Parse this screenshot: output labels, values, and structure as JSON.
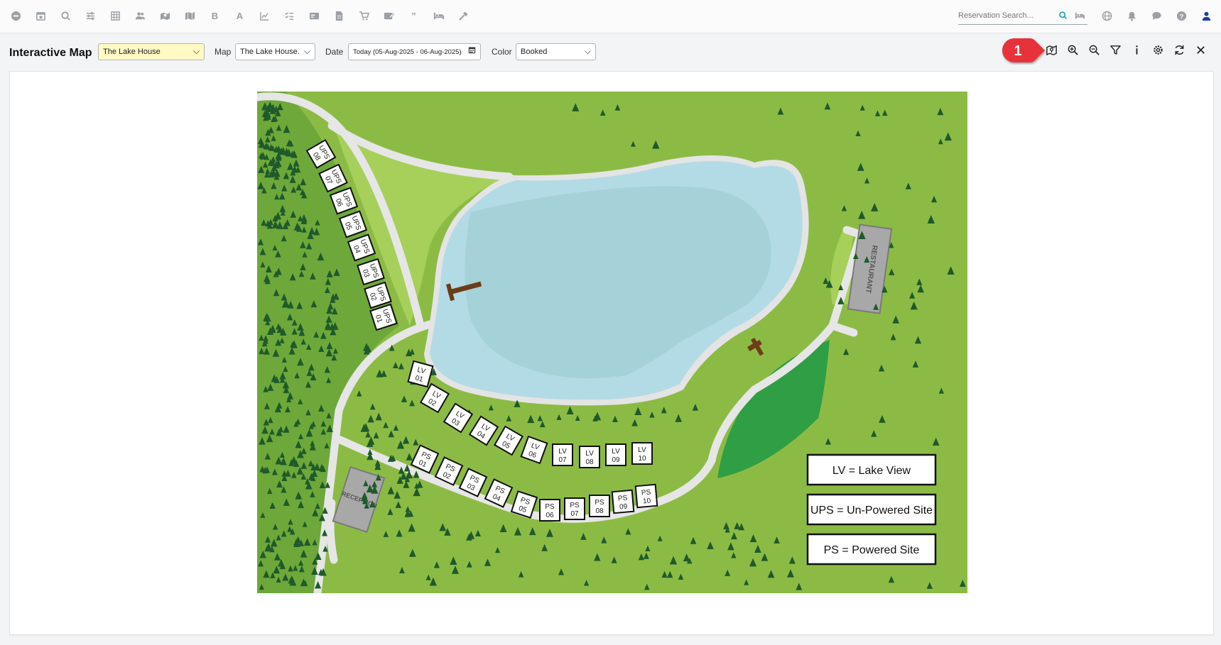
{
  "topbar": {
    "icons": [
      "minus-circle-icon",
      "calendar-icon",
      "search-icon",
      "sliders-icon",
      "grid-icon",
      "users-icon",
      "map-pin-icon",
      "map-icon",
      "bold-b-icon",
      "font-a-icon",
      "line-chart-icon",
      "checklist-icon",
      "card-icon",
      "document-icon",
      "cart-icon",
      "edit-card-icon",
      "quote-icon",
      "bed-icon",
      "wrench-icon"
    ],
    "search_placeholder": "Reservation Search...",
    "right_icons": [
      "globe-icon",
      "bell-icon",
      "chat-icon",
      "help-icon",
      "user-icon"
    ]
  },
  "toolbar": {
    "title": "Interactive Map",
    "property_value": "The Lake House",
    "map_label": "Map",
    "map_value": "The Lake House.",
    "date_label": "Date",
    "date_value": "Today (05-Aug-2025 - 06-Aug-2025)",
    "color_label": "Color",
    "color_value": "Booked",
    "callout_number": "1",
    "right_icons": [
      "map-view-icon",
      "zoom-in-icon",
      "zoom-out-icon",
      "filter-icon",
      "info-icon",
      "settings-icon",
      "refresh-icon",
      "close-icon"
    ]
  },
  "map": {
    "restaurant_label": "RESTAURANT",
    "reception_label": "RECEPTION",
    "legend": [
      "LV = Lake View",
      "UPS = Un-Powered Site",
      "PS = Powered Site"
    ],
    "ups_sites": [
      {
        "l1": "UPS",
        "l2": "08"
      },
      {
        "l1": "UPS",
        "l2": "07"
      },
      {
        "l1": "UPS",
        "l2": "06"
      },
      {
        "l1": "UPS",
        "l2": "05"
      },
      {
        "l1": "UPS",
        "l2": "04"
      },
      {
        "l1": "UPS",
        "l2": "03"
      },
      {
        "l1": "UPS",
        "l2": "02"
      },
      {
        "l1": "UPS",
        "l2": "01"
      }
    ],
    "lv_sites": [
      {
        "l1": "LV",
        "l2": "01"
      },
      {
        "l1": "LV",
        "l2": "02"
      },
      {
        "l1": "LV",
        "l2": "03"
      },
      {
        "l1": "LV",
        "l2": "04"
      },
      {
        "l1": "LV",
        "l2": "05"
      },
      {
        "l1": "LV",
        "l2": "06"
      },
      {
        "l1": "LV",
        "l2": "07"
      },
      {
        "l1": "LV",
        "l2": "08"
      },
      {
        "l1": "LV",
        "l2": "09"
      },
      {
        "l1": "LV",
        "l2": "10"
      }
    ],
    "ps_sites": [
      {
        "l1": "PS",
        "l2": "01"
      },
      {
        "l1": "PS",
        "l2": "02"
      },
      {
        "l1": "PS",
        "l2": "03"
      },
      {
        "l1": "PS",
        "l2": "04"
      },
      {
        "l1": "PS",
        "l2": "05"
      },
      {
        "l1": "PS",
        "l2": "06"
      },
      {
        "l1": "PS",
        "l2": "07"
      },
      {
        "l1": "PS",
        "l2": "08"
      },
      {
        "l1": "PS",
        "l2": "09"
      },
      {
        "l1": "PS",
        "l2": "10"
      }
    ]
  }
}
